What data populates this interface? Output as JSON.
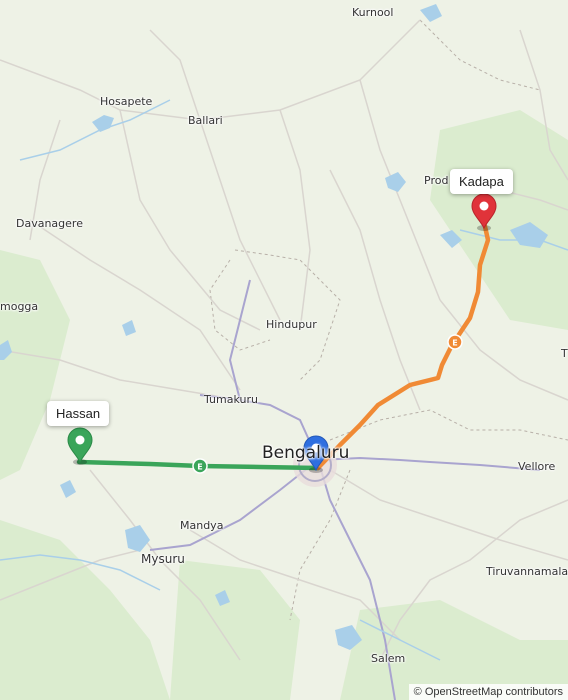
{
  "map": {
    "cities": [
      {
        "id": "kurnool",
        "label": "Kurnool"
      },
      {
        "id": "hosapete",
        "label": "Hosapete"
      },
      {
        "id": "ballari",
        "label": "Ballari"
      },
      {
        "id": "davanagere",
        "label": "Davanagere"
      },
      {
        "id": "proddatur",
        "label": "Prod"
      },
      {
        "id": "shivamogga",
        "label": "mogga"
      },
      {
        "id": "hindupur",
        "label": "Hindupur"
      },
      {
        "id": "tumakuru",
        "label": "Tumakuru"
      },
      {
        "id": "bengaluru",
        "label": "Bengaluru"
      },
      {
        "id": "mandya",
        "label": "Mandya"
      },
      {
        "id": "mysuru",
        "label": "Mysuru"
      },
      {
        "id": "vellore",
        "label": "Vellore"
      },
      {
        "id": "tiruvannamalai",
        "label": "Tiruvannamalai"
      },
      {
        "id": "salem",
        "label": "Salem"
      },
      {
        "id": "tirupati_edge",
        "label": "T"
      }
    ],
    "markers": {
      "start": {
        "label": "Hassan",
        "color": "#3aa55a"
      },
      "center": {
        "color": "#2f6fe0"
      },
      "end": {
        "label": "Kadapa",
        "color": "#e0333a"
      }
    },
    "routes": [
      {
        "id": "hassan-bengaluru",
        "color": "#3aa55a",
        "shield": "E"
      },
      {
        "id": "bengaluru-kadapa",
        "color": "#f08a35",
        "shield": "E"
      }
    ],
    "attribution": "© OpenStreetMap contributors"
  }
}
